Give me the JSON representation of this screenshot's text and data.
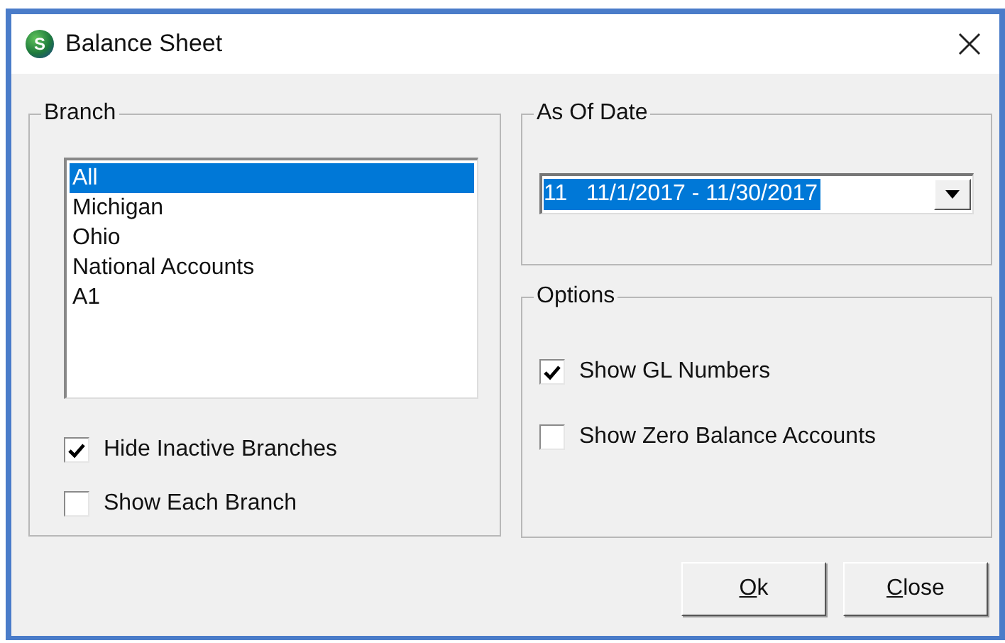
{
  "window": {
    "title": "Balance Sheet",
    "icon_letter": "S"
  },
  "branch": {
    "title": "Branch",
    "items": [
      {
        "label": "All",
        "selected": true
      },
      {
        "label": "Michigan",
        "selected": false
      },
      {
        "label": "Ohio",
        "selected": false
      },
      {
        "label": "National Accounts",
        "selected": false
      },
      {
        "label": "A1",
        "selected": false
      }
    ],
    "checkboxes": [
      {
        "label": "Hide Inactive Branches",
        "checked": true
      },
      {
        "label": "Show Each Branch",
        "checked": false
      }
    ]
  },
  "as_of_date": {
    "title": "As Of Date",
    "value": "11   11/1/2017 - 11/30/2017"
  },
  "options": {
    "title": "Options",
    "checkboxes": [
      {
        "label": "Show GL Numbers",
        "checked": true
      },
      {
        "label": "Show Zero Balance Accounts",
        "checked": false
      }
    ]
  },
  "buttons": [
    {
      "label": "Ok"
    },
    {
      "label": "Close"
    }
  ]
}
